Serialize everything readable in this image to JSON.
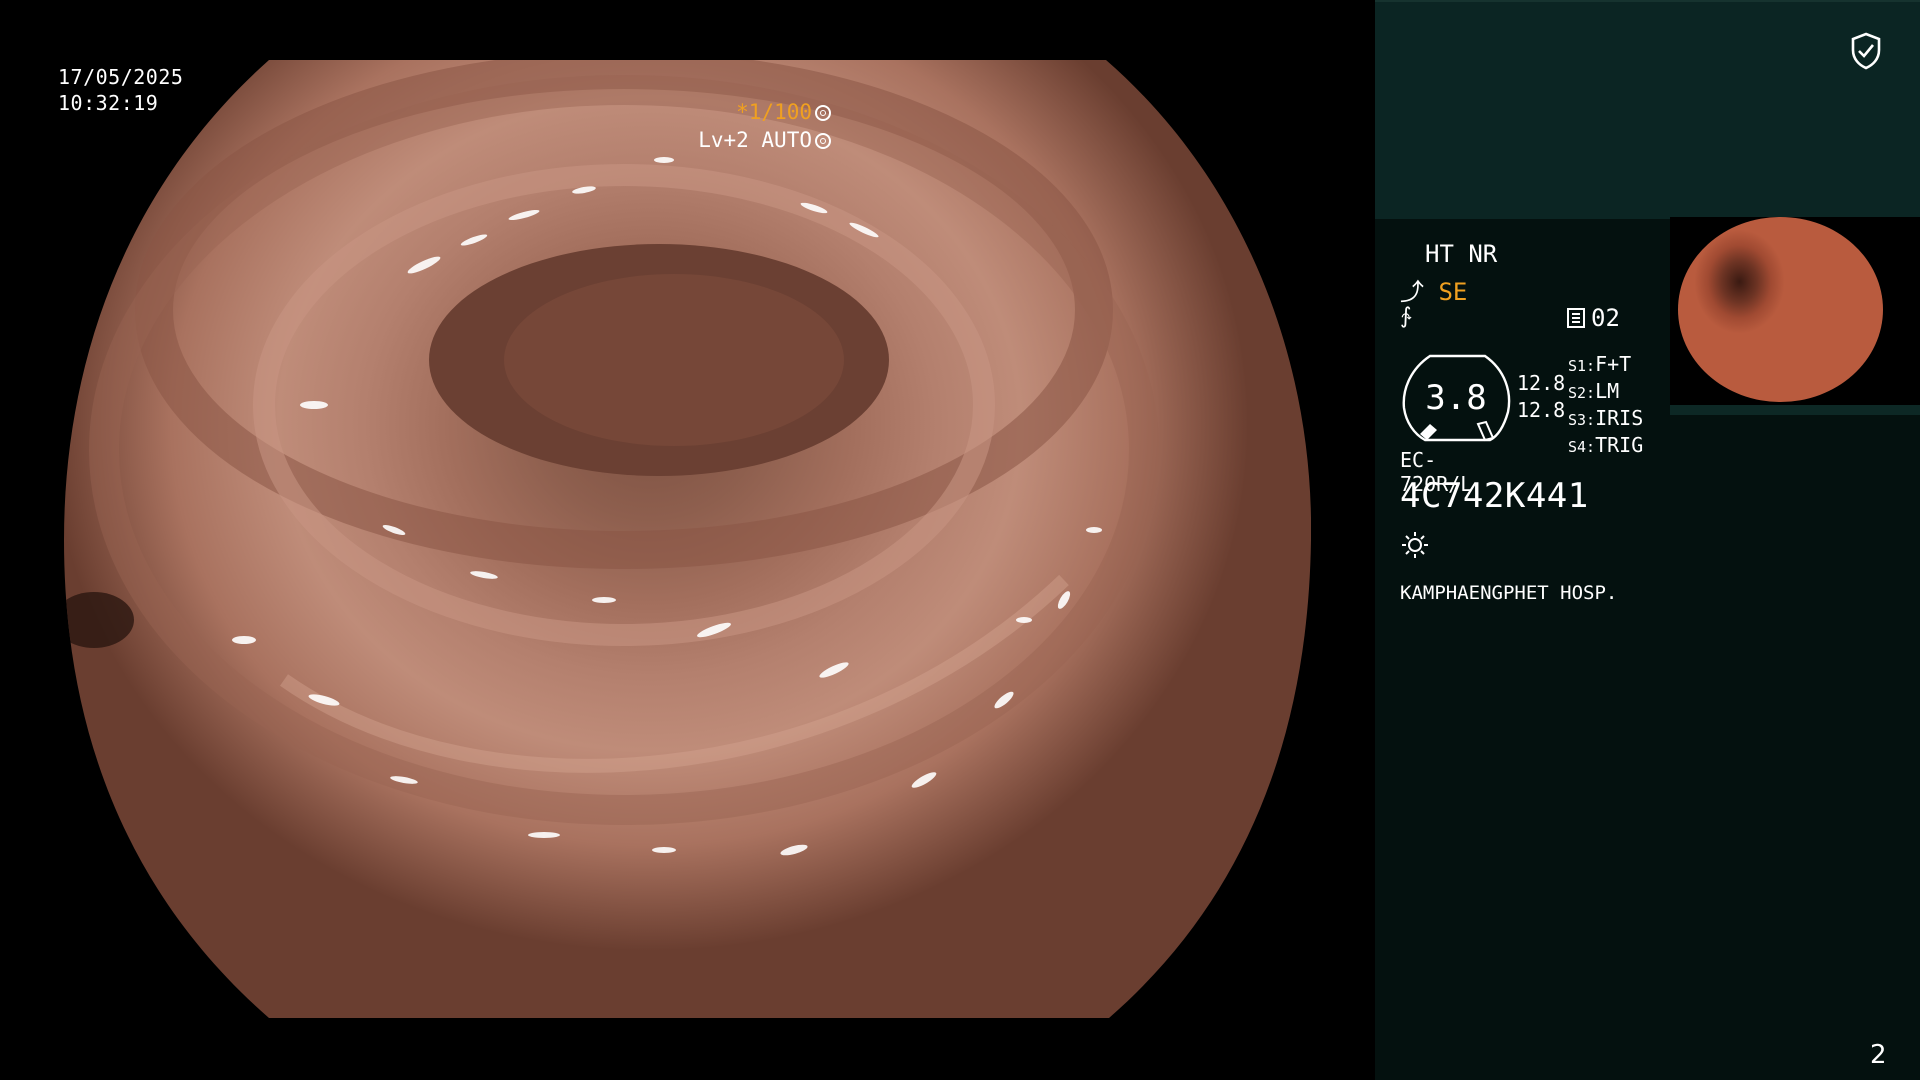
{
  "overlay": {
    "date": "17/05/2025",
    "time": "10:32:19",
    "shutter_speed": "*1/100",
    "level": "Lv+2 AUTO"
  },
  "panel": {
    "mode_label": "HT NR",
    "mode_se": "SE",
    "image_count": "02",
    "gauge_value": "3.8",
    "values": [
      "12.8",
      "12.8"
    ],
    "switches": [
      {
        "key": "S1:",
        "value": "F+T"
      },
      {
        "key": "S2:",
        "value": "LM"
      },
      {
        "key": "S3:",
        "value": "IRIS"
      },
      {
        "key": "S4:",
        "value": "TRIG"
      }
    ],
    "scope_model": "EC-720R/L",
    "serial_number": "4C742K441",
    "hospital": "KAMPHAENGPHET HOSP.",
    "page_number": "2"
  },
  "icons": {
    "shield": "shield-check-icon",
    "grip": "lift-arrow-icon",
    "wave": "signal-wave-icon",
    "list": "memo-list-icon",
    "sun": "light-source-icon",
    "aperture": "aperture-icon"
  },
  "colors": {
    "accent_orange": "#f0a020",
    "panel_bg": "#04110f",
    "panel_top_bg": "#0b2523"
  }
}
